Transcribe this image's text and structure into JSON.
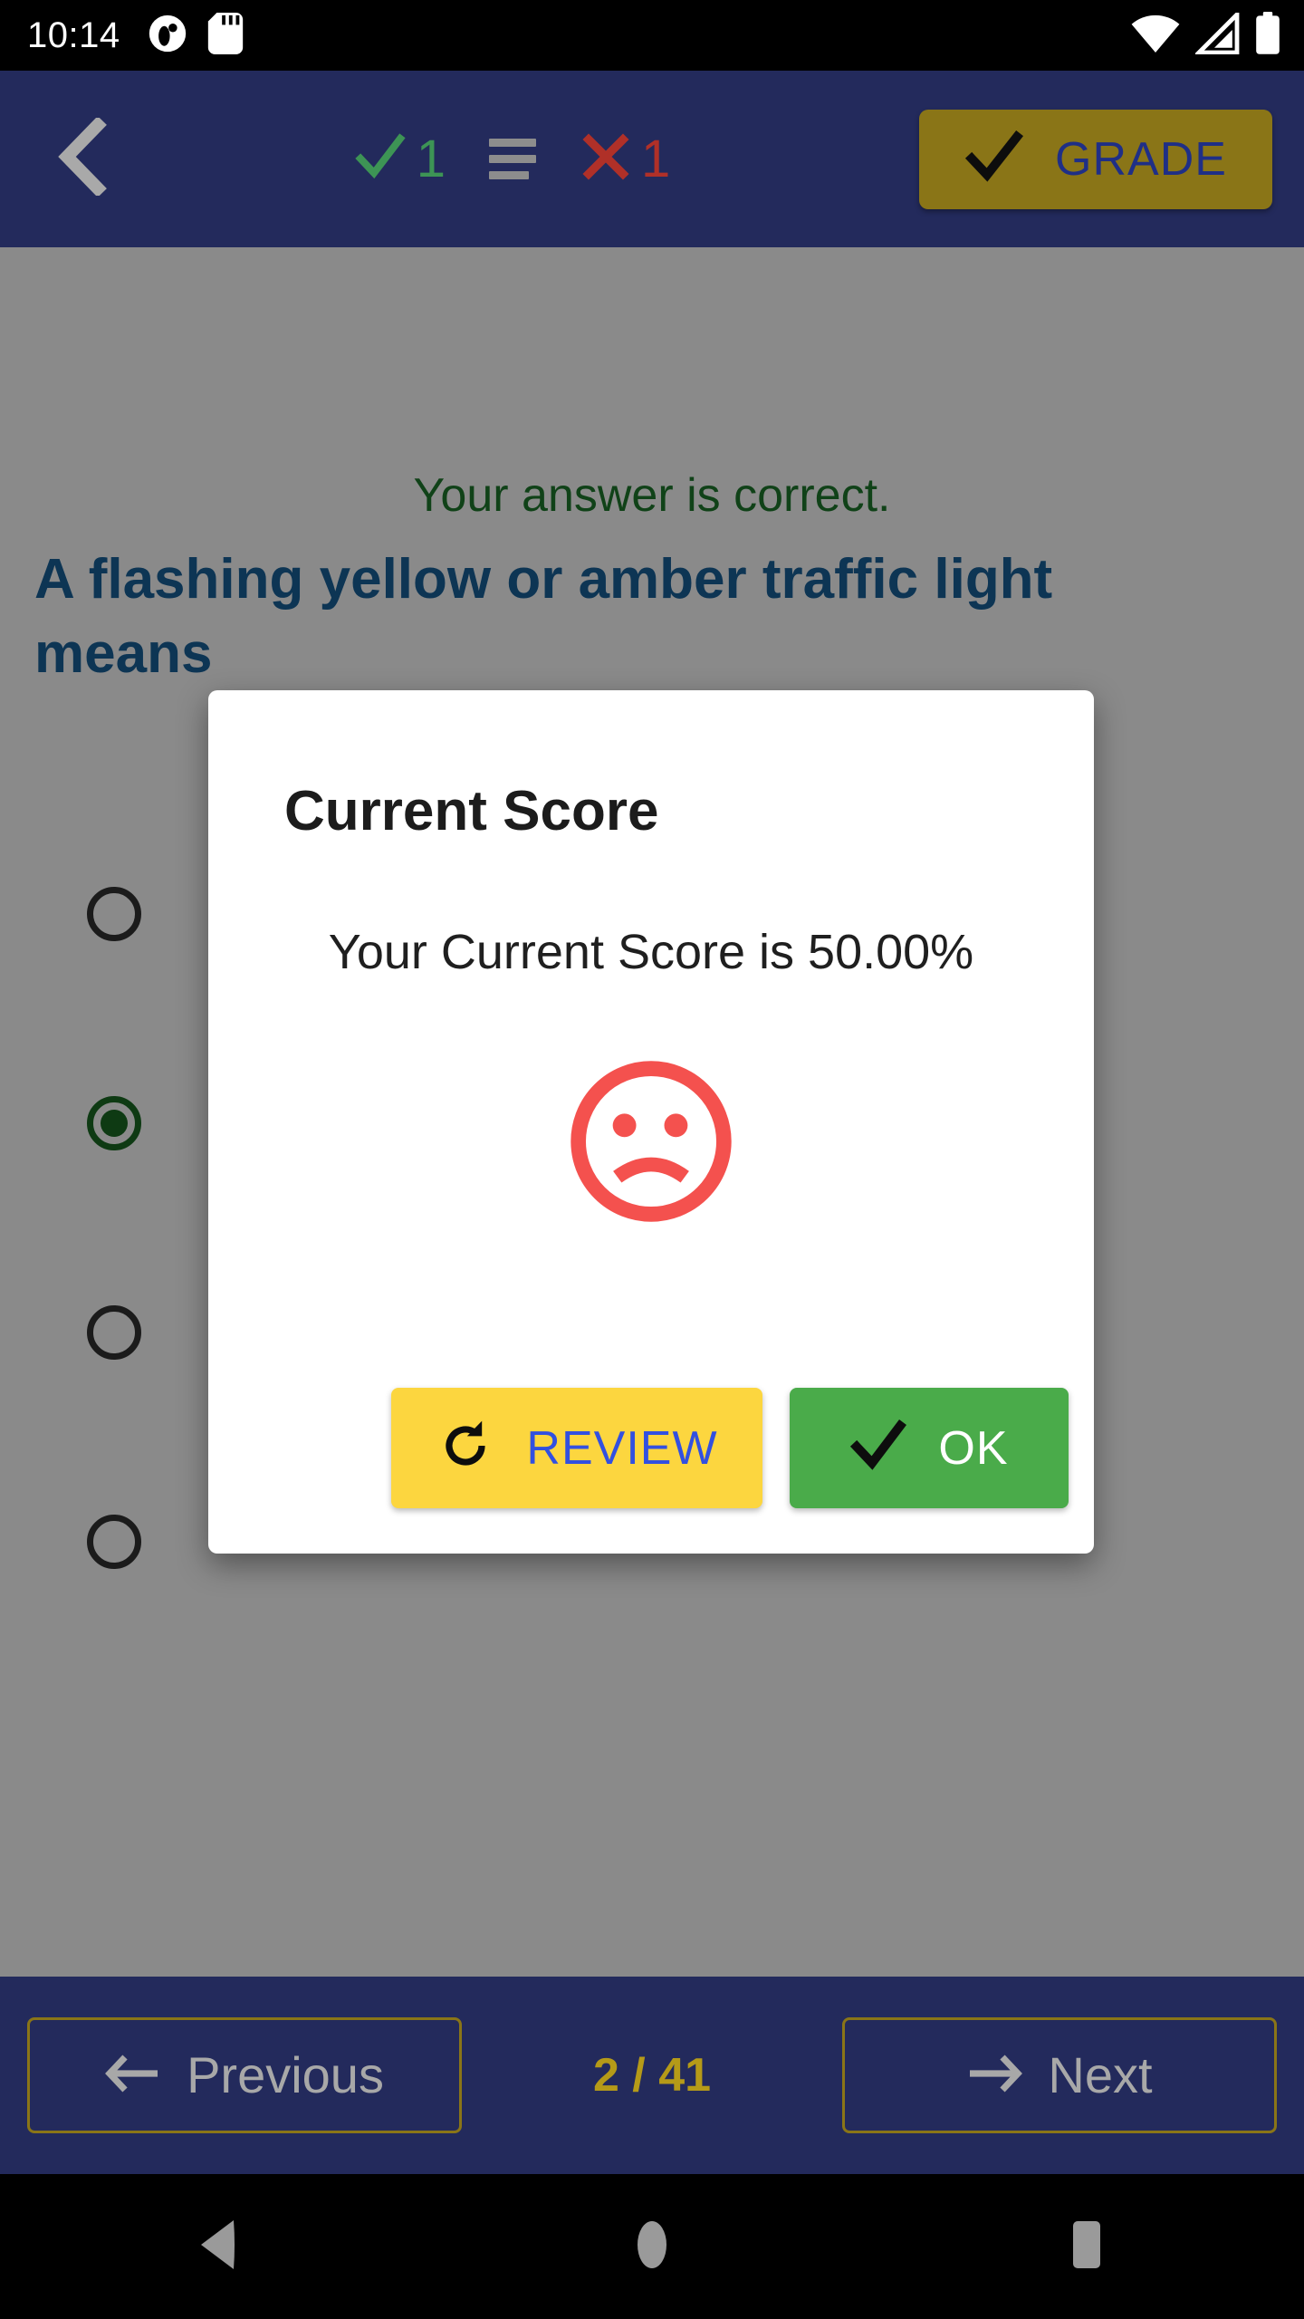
{
  "status_bar": {
    "time": "10:14",
    "left_icons": [
      "sd-card-icon",
      "app-notification-icon"
    ],
    "right_icons": [
      "wifi-icon",
      "cellular-signal-icon",
      "battery-icon"
    ]
  },
  "header": {
    "back_icon": "chevron-left-icon",
    "correct_count": "1",
    "wrong_count": "1",
    "list_icon": "list-icon",
    "grade_label": "GRADE",
    "grade_icon": "check-icon",
    "background_color": "#232a5c",
    "grade_button_color": "#8a7517",
    "grade_label_color": "#1f2f86"
  },
  "content": {
    "feedback": "Your answer is correct.",
    "feedback_color": "#1f7a2e",
    "question": "A flashing yellow or amber traffic light means",
    "question_color": "#19629c",
    "options": [
      {
        "label": "",
        "selected": false
      },
      {
        "label": "",
        "selected": true
      },
      {
        "label": "",
        "selected": false
      },
      {
        "label": "",
        "selected": false
      }
    ],
    "selected_radio_color": "#1a6b24"
  },
  "dialog": {
    "title": "Current Score",
    "message": "Your Current Score is 50.00%",
    "score_percent": "50.00%",
    "mood_icon": "sad-face-icon",
    "mood_icon_color": "#f4514e",
    "review_label": "REVIEW",
    "review_icon": "refresh-icon",
    "review_button_color": "#fcd63f",
    "review_label_color": "#3250e0",
    "ok_label": "OK",
    "ok_icon": "check-icon",
    "ok_button_color": "#4aab4a",
    "ok_label_color": "#ffffff"
  },
  "bottom_bar": {
    "previous_label": "Previous",
    "previous_icon": "arrow-left-icon",
    "next_label": "Next",
    "next_icon": "arrow-right-icon",
    "page_indicator": "2 / 41",
    "page_indicator_color": "#b59a18",
    "border_color": "#8a7517",
    "label_color": "#a8a8a8"
  },
  "system_nav": {
    "back_icon": "triangle-back-icon",
    "home_icon": "circle-home-icon",
    "recents_icon": "square-recents-icon",
    "icon_color": "#9a9a9a"
  }
}
